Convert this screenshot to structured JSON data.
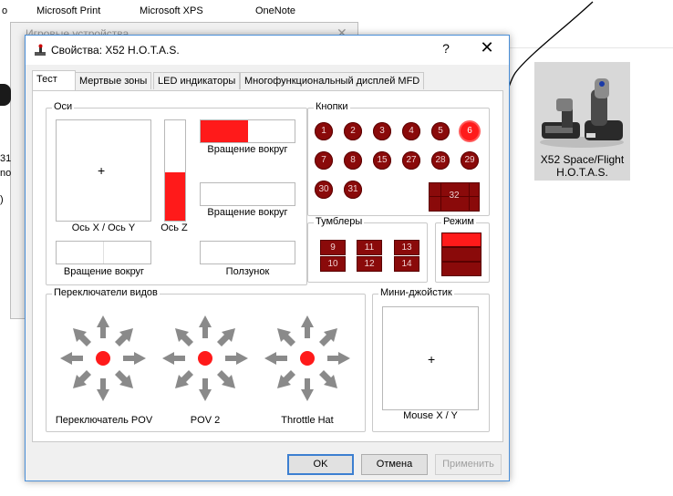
{
  "background": {
    "top_items": [
      "o",
      "Microsoft Print",
      "Microsoft XPS",
      "OneNote"
    ],
    "back_window_title": "Игровые устройства",
    "back_window_close": "✕",
    "side_fragments": [
      "31",
      "no",
      ")"
    ],
    "device_tile": {
      "name_line1": "X52 Space/Flight",
      "name_line2": "H.O.T.A.S."
    }
  },
  "dialog": {
    "title": "Свойства: X52 H.O.T.A.S.",
    "help_label": "?",
    "close_label": "✕",
    "tabs": [
      {
        "label": "Тест",
        "active": true
      },
      {
        "label": "Мертвые зоны",
        "active": false
      },
      {
        "label": "LED индикаторы",
        "active": false
      },
      {
        "label": "Многофункциональный дисплей MFD",
        "active": false
      }
    ],
    "axes": {
      "title": "Оси",
      "xy_label": "Ось X / Ось Y",
      "z_label": "Ось Z",
      "z_fill_fraction": 0.48,
      "rot1_label": "Вращение вокруг",
      "rot1_fill_fraction": 0.5,
      "rot2_label": "Вращение вокруг",
      "rot3_label": "Вращение вокруг",
      "slider_label": "Ползунок",
      "crosshair": "+"
    },
    "buttons": {
      "title": "Кнопки",
      "items": [
        "1",
        "2",
        "3",
        "4",
        "5",
        "6",
        "7",
        "8",
        "15",
        "27",
        "28",
        "29",
        "30",
        "31"
      ],
      "pressed": "6",
      "big_button": "32"
    },
    "toggles": {
      "title": "Тумблеры",
      "items": [
        "9",
        "11",
        "13",
        "10",
        "12",
        "14"
      ]
    },
    "mode": {
      "title": "Режим",
      "active_index": 0
    },
    "pov": {
      "title": "Переключатели видов",
      "hats": [
        "Переключатель POV",
        "POV 2",
        "Throttle Hat"
      ]
    },
    "mini_stick": {
      "title": "Мини-джойстик",
      "label": "Mouse X / Y",
      "crosshair": "+"
    },
    "footer": {
      "ok": "OK",
      "cancel": "Отмена",
      "apply": "Применить"
    },
    "colors": {
      "active_red": "#ff1a1a",
      "inactive_red": "#8a0a0a",
      "accent_blue": "#3c7fd1"
    }
  }
}
